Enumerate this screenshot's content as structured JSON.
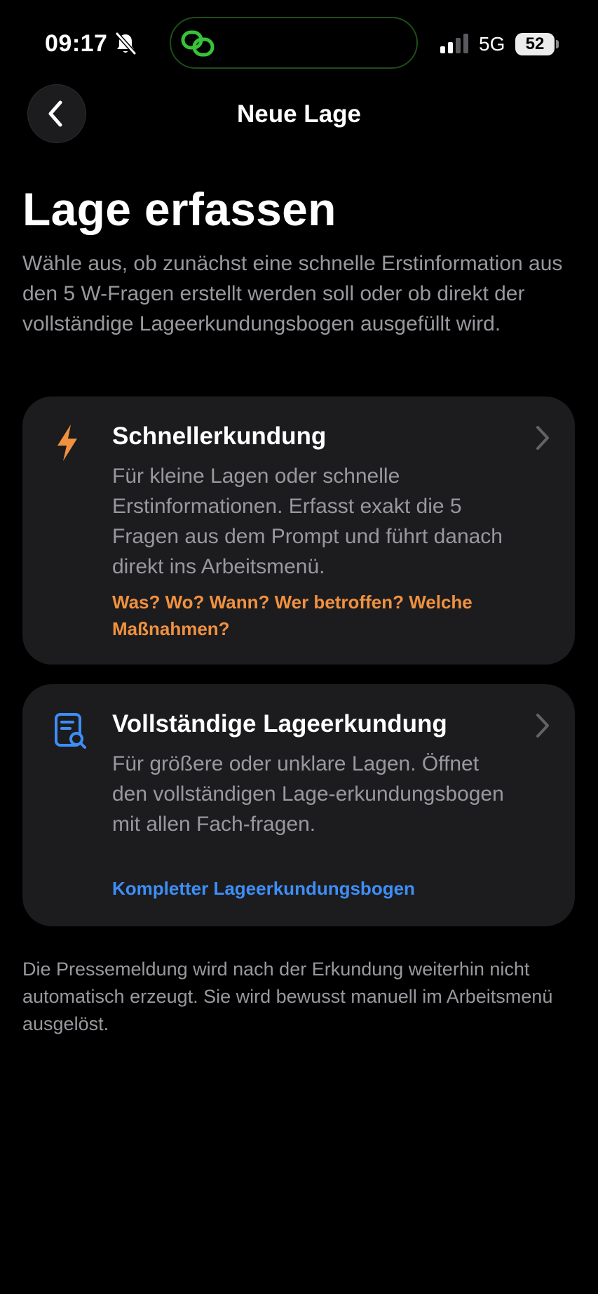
{
  "status_bar": {
    "time": "09:17",
    "network": "5G",
    "battery": "52",
    "accent_color": "#38c23a"
  },
  "nav": {
    "title": "Neue Lage",
    "back_icon": "chevron-left-icon"
  },
  "header": {
    "title": "Lage erfassen",
    "subtitle": "Wähle aus, ob zunächst eine schnelle Erstinformation aus den 5 W-Fragen erstellt werden soll oder ob direkt der vollständige Lageerkundungsbogen ausgefüllt wird."
  },
  "options": [
    {
      "icon": "lightning-bolt-icon",
      "title": "Schnellerkundung",
      "description": "Für kleine Lagen oder schnelle Erstinformationen. Erfasst exakt die 5 Fragen aus dem Prompt und führt danach direkt ins Arbeitsmenü.",
      "hint": "Was? Wo? Wann? Wer betroffen? Welche Maßnahmen?",
      "accent_color": "#f0913f"
    },
    {
      "icon": "document-search-icon",
      "title": "Vollständige Lageerkundung",
      "description": "Für größere oder unklare Lagen. Öffnet den vollständigen Lage-erkundungsbogen mit allen Fach-fragen.",
      "hint": "Kompletter Lageerkundungsbogen",
      "accent_color": "#3e8ef7"
    }
  ],
  "footer": {
    "note": "Die Pressemeldung wird nach der Erkundung weiterhin nicht automatisch erzeugt. Sie wird bewusst manuell im Arbeitsmenü ausgelöst."
  }
}
